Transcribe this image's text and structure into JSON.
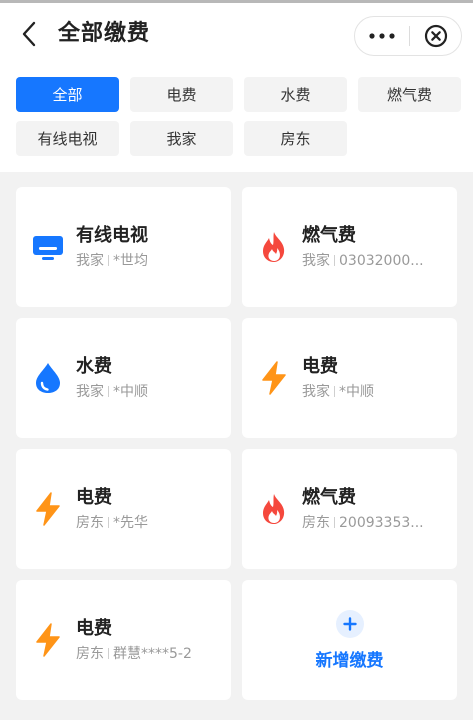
{
  "header": {
    "title": "全部缴费"
  },
  "filters": [
    {
      "label": "全部",
      "active": true
    },
    {
      "label": "电费",
      "active": false
    },
    {
      "label": "水费",
      "active": false
    },
    {
      "label": "燃气费",
      "active": false
    },
    {
      "label": "有线电视",
      "active": false
    },
    {
      "label": "我家",
      "active": false
    },
    {
      "label": "房东",
      "active": false
    }
  ],
  "cards": [
    {
      "name": "有线电视",
      "group": "我家",
      "account": "*世均",
      "icon": "tv-icon",
      "color": "#1677ff"
    },
    {
      "name": "燃气费",
      "group": "我家",
      "account": "03032000...",
      "icon": "flame-icon",
      "color": "#f5483d"
    },
    {
      "name": "水费",
      "group": "我家",
      "account": "*中顺",
      "icon": "water-drop-icon",
      "color": "#1677ff"
    },
    {
      "name": "电费",
      "group": "我家",
      "account": "*中顺",
      "icon": "lightning-icon",
      "color": "#ff9417"
    },
    {
      "name": "电费",
      "group": "房东",
      "account": "*先华",
      "icon": "lightning-icon",
      "color": "#ff9417"
    },
    {
      "name": "燃气费",
      "group": "房东",
      "account": "20093353...",
      "icon": "flame-icon",
      "color": "#f5483d"
    },
    {
      "name": "电费",
      "group": "房东",
      "account": "群慧****5-2",
      "icon": "lightning-icon",
      "color": "#ff9417"
    }
  ],
  "add_card": {
    "label": "新增缴费",
    "icon": "plus-icon"
  },
  "colors": {
    "accent": "#1677ff",
    "electricity": "#ff9417",
    "gas": "#f5483d"
  }
}
